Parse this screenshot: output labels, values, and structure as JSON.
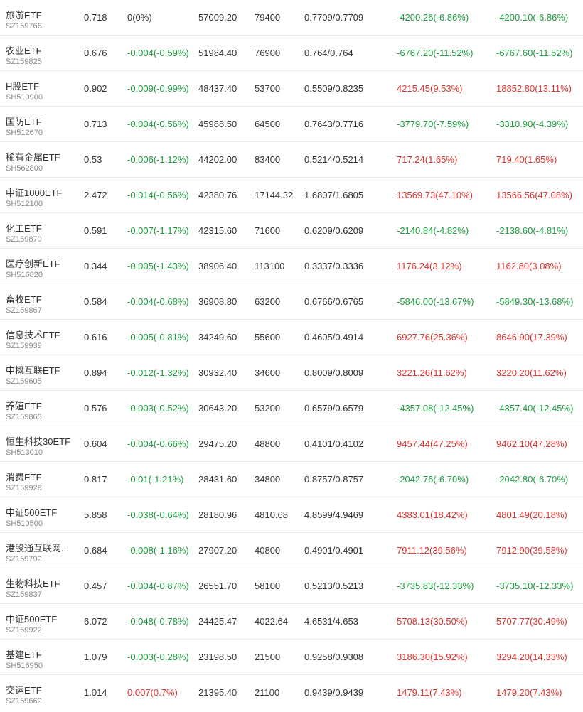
{
  "colors": {
    "up": "#e0322d",
    "down": "#1a9c3c",
    "flat": "#333333",
    "code": "#888888",
    "divider": "#ececec"
  },
  "rows": [
    {
      "name": "旅游ETF",
      "code": "SZ159766",
      "price": "0.718",
      "change": "0(0%)",
      "change_dir": "flat",
      "amount": "57009.20",
      "shares": "79400",
      "cost": "0.7709/0.7709",
      "pl1": "-4200.26(-6.86%)",
      "pl1_dir": "down",
      "pl2": "-4200.10(-6.86%)",
      "pl2_dir": "down"
    },
    {
      "name": "农业ETF",
      "code": "SZ159825",
      "price": "0.676",
      "change": "-0.004(-0.59%)",
      "change_dir": "down",
      "amount": "51984.40",
      "shares": "76900",
      "cost": "0.764/0.764",
      "pl1": "-6767.20(-11.52%)",
      "pl1_dir": "down",
      "pl2": "-6767.60(-11.52%)",
      "pl2_dir": "down"
    },
    {
      "name": "H股ETF",
      "code": "SH510900",
      "price": "0.902",
      "change": "-0.009(-0.99%)",
      "change_dir": "down",
      "amount": "48437.40",
      "shares": "53700",
      "cost": "0.5509/0.8235",
      "pl1": "4215.45(9.53%)",
      "pl1_dir": "up",
      "pl2": "18852.80(13.11%)",
      "pl2_dir": "up"
    },
    {
      "name": "国防ETF",
      "code": "SH512670",
      "price": "0.713",
      "change": "-0.004(-0.56%)",
      "change_dir": "down",
      "amount": "45988.50",
      "shares": "64500",
      "cost": "0.7643/0.7716",
      "pl1": "-3779.70(-7.59%)",
      "pl1_dir": "down",
      "pl2": "-3310.90(-4.39%)",
      "pl2_dir": "down"
    },
    {
      "name": "稀有金属ETF",
      "code": "SH562800",
      "price": "0.53",
      "change": "-0.006(-1.12%)",
      "change_dir": "down",
      "amount": "44202.00",
      "shares": "83400",
      "cost": "0.5214/0.5214",
      "pl1": "717.24(1.65%)",
      "pl1_dir": "up",
      "pl2": "719.40(1.65%)",
      "pl2_dir": "up"
    },
    {
      "name": "中证1000ETF",
      "code": "SH512100",
      "price": "2.472",
      "change": "-0.014(-0.56%)",
      "change_dir": "down",
      "amount": "42380.76",
      "shares": "17144.32",
      "cost": "1.6807/1.6805",
      "pl1": "13569.73(47.10%)",
      "pl1_dir": "up",
      "pl2": "13566.56(47.08%)",
      "pl2_dir": "up"
    },
    {
      "name": "化工ETF",
      "code": "SZ159870",
      "price": "0.591",
      "change": "-0.007(-1.17%)",
      "change_dir": "down",
      "amount": "42315.60",
      "shares": "71600",
      "cost": "0.6209/0.6209",
      "pl1": "-2140.84(-4.82%)",
      "pl1_dir": "down",
      "pl2": "-2138.60(-4.81%)",
      "pl2_dir": "down"
    },
    {
      "name": "医疗创新ETF",
      "code": "SH516820",
      "price": "0.344",
      "change": "-0.005(-1.43%)",
      "change_dir": "down",
      "amount": "38906.40",
      "shares": "113100",
      "cost": "0.3337/0.3336",
      "pl1": "1176.24(3.12%)",
      "pl1_dir": "up",
      "pl2": "1162.80(3.08%)",
      "pl2_dir": "up"
    },
    {
      "name": "畜牧ETF",
      "code": "SZ159867",
      "price": "0.584",
      "change": "-0.004(-0.68%)",
      "change_dir": "down",
      "amount": "36908.80",
      "shares": "63200",
      "cost": "0.6766/0.6765",
      "pl1": "-5846.00(-13.67%)",
      "pl1_dir": "down",
      "pl2": "-5849.30(-13.68%)",
      "pl2_dir": "down"
    },
    {
      "name": "信息技术ETF",
      "code": "SZ159939",
      "price": "0.616",
      "change": "-0.005(-0.81%)",
      "change_dir": "down",
      "amount": "34249.60",
      "shares": "55600",
      "cost": "0.4605/0.4914",
      "pl1": "6927.76(25.36%)",
      "pl1_dir": "up",
      "pl2": "8646.90(17.39%)",
      "pl2_dir": "up"
    },
    {
      "name": "中概互联ETF",
      "code": "SZ159605",
      "price": "0.894",
      "change": "-0.012(-1.32%)",
      "change_dir": "down",
      "amount": "30932.40",
      "shares": "34600",
      "cost": "0.8009/0.8009",
      "pl1": "3221.26(11.62%)",
      "pl1_dir": "up",
      "pl2": "3220.20(11.62%)",
      "pl2_dir": "up"
    },
    {
      "name": "养殖ETF",
      "code": "SZ159865",
      "price": "0.576",
      "change": "-0.003(-0.52%)",
      "change_dir": "down",
      "amount": "30643.20",
      "shares": "53200",
      "cost": "0.6579/0.6579",
      "pl1": "-4357.08(-12.45%)",
      "pl1_dir": "down",
      "pl2": "-4357.40(-12.45%)",
      "pl2_dir": "down"
    },
    {
      "name": "恒生科技30ETF",
      "code": "SH513010",
      "price": "0.604",
      "change": "-0.004(-0.66%)",
      "change_dir": "down",
      "amount": "29475.20",
      "shares": "48800",
      "cost": "0.4101/0.4102",
      "pl1": "9457.44(47.25%)",
      "pl1_dir": "up",
      "pl2": "9462.10(47.28%)",
      "pl2_dir": "up"
    },
    {
      "name": "消费ETF",
      "code": "SZ159928",
      "price": "0.817",
      "change": "-0.01(-1.21%)",
      "change_dir": "down",
      "amount": "28431.60",
      "shares": "34800",
      "cost": "0.8757/0.8757",
      "pl1": "-2042.76(-6.70%)",
      "pl1_dir": "down",
      "pl2": "-2042.80(-6.70%)",
      "pl2_dir": "down"
    },
    {
      "name": "中证500ETF",
      "code": "SH510500",
      "price": "5.858",
      "change": "-0.038(-0.64%)",
      "change_dir": "down",
      "amount": "28180.96",
      "shares": "4810.68",
      "cost": "4.8599/4.9469",
      "pl1": "4383.01(18.42%)",
      "pl1_dir": "up",
      "pl2": "4801.49(20.18%)",
      "pl2_dir": "up"
    },
    {
      "name": "港股通互联网...",
      "code": "SZ159792",
      "price": "0.684",
      "change": "-0.008(-1.16%)",
      "change_dir": "down",
      "amount": "27907.20",
      "shares": "40800",
      "cost": "0.4901/0.4901",
      "pl1": "7911.12(39.56%)",
      "pl1_dir": "up",
      "pl2": "7912.90(39.58%)",
      "pl2_dir": "up"
    },
    {
      "name": "生物科技ETF",
      "code": "SZ159837",
      "price": "0.457",
      "change": "-0.004(-0.87%)",
      "change_dir": "down",
      "amount": "26551.70",
      "shares": "58100",
      "cost": "0.5213/0.5213",
      "pl1": "-3735.83(-12.33%)",
      "pl1_dir": "down",
      "pl2": "-3735.10(-12.33%)",
      "pl2_dir": "down"
    },
    {
      "name": "中证500ETF",
      "code": "SZ159922",
      "price": "6.072",
      "change": "-0.048(-0.78%)",
      "change_dir": "down",
      "amount": "24425.47",
      "shares": "4022.64",
      "cost": "4.6531/4.653",
      "pl1": "5708.13(30.50%)",
      "pl1_dir": "up",
      "pl2": "5707.77(30.49%)",
      "pl2_dir": "up"
    },
    {
      "name": "基建ETF",
      "code": "SH516950",
      "price": "1.079",
      "change": "-0.003(-0.28%)",
      "change_dir": "down",
      "amount": "23198.50",
      "shares": "21500",
      "cost": "0.9258/0.9308",
      "pl1": "3186.30(15.92%)",
      "pl1_dir": "up",
      "pl2": "3294.20(14.33%)",
      "pl2_dir": "up"
    },
    {
      "name": "交运ETF",
      "code": "SZ159662",
      "price": "1.014",
      "change": "0.007(0.7%)",
      "change_dir": "up",
      "amount": "21395.40",
      "shares": "21100",
      "cost": "0.9439/0.9439",
      "pl1": "1479.11(7.43%)",
      "pl1_dir": "up",
      "pl2": "1479.20(7.43%)",
      "pl2_dir": "up"
    }
  ]
}
